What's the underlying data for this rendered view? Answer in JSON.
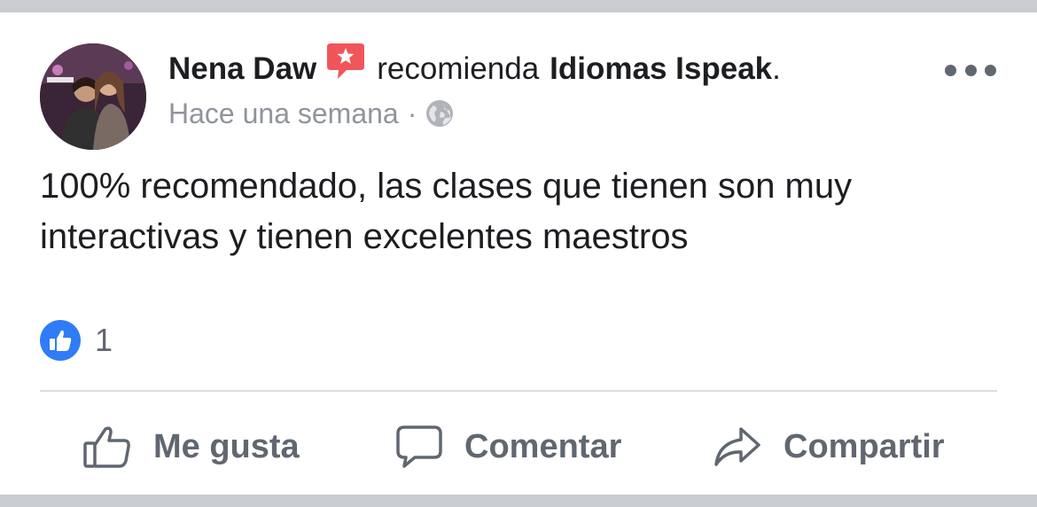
{
  "post": {
    "author": "Nena Daw",
    "verb": "recomienda",
    "page": "Idiomas Ispeak",
    "page_suffix": ".",
    "timestamp": "Hace una semana",
    "separator": "·",
    "text": "100% recomendado, las clases que tienen son muy interactivas y tienen excelentes maestros"
  },
  "reactions": {
    "count": "1",
    "icon": "like-icon"
  },
  "actions": {
    "like_label": "Me gusta",
    "comment_label": "Comentar",
    "share_label": "Compartir"
  },
  "icons": {
    "recommend_badge": "recommend-star-icon",
    "audience": "globe-icon",
    "more": "more-options-icon",
    "like": "thumbs-up-icon",
    "comment": "comment-bubble-icon",
    "share": "share-arrow-icon"
  },
  "colors": {
    "recommend_badge": "#f0555a",
    "like_badge": "#2f7cf6",
    "text": "#1c1e21",
    "secondary_text": "#606770",
    "muted_text": "#90949c",
    "divider": "#dadde1",
    "background_band": "#c9ccd1"
  }
}
